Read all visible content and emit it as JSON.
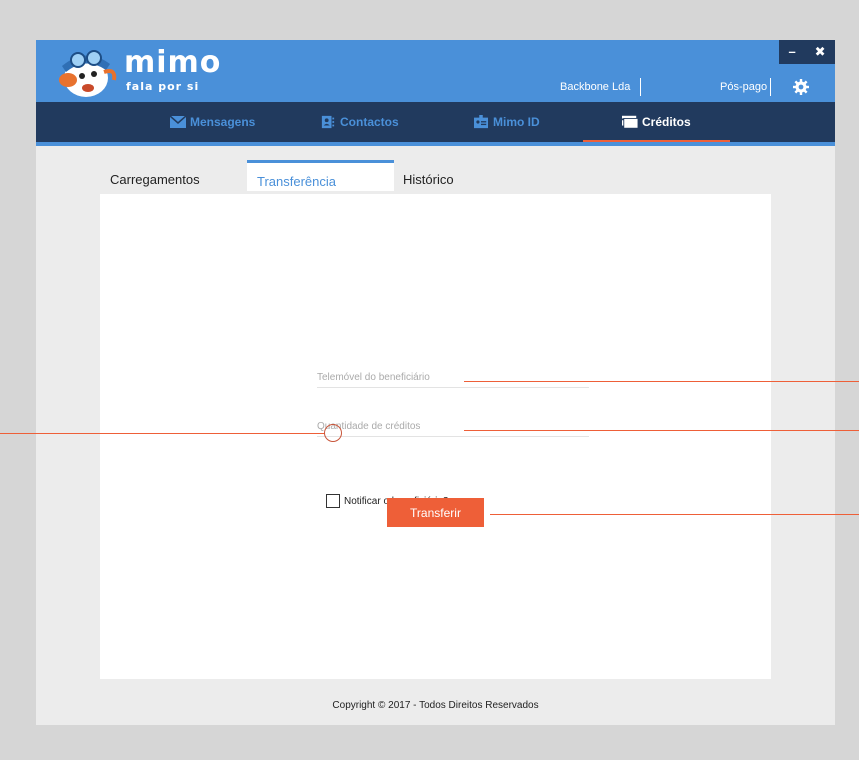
{
  "app": {
    "brand": "mimo",
    "tagline": "fala por si",
    "account_name": "Backbone Lda",
    "plan": "Pós-pago",
    "window_controls": {
      "minimize": "–",
      "close": "✖"
    }
  },
  "nav": {
    "items": [
      {
        "label": "Mensagens",
        "icon": "envelope-icon"
      },
      {
        "label": "Contactos",
        "icon": "contacts-icon"
      },
      {
        "label": "Mimo ID",
        "icon": "id-card-icon"
      },
      {
        "label": "Créditos",
        "icon": "credit-card-icon",
        "active": true
      }
    ]
  },
  "tabs": [
    {
      "label": "Carregamentos"
    },
    {
      "label": "Transferência",
      "active": true
    },
    {
      "label": "Histórico"
    }
  ],
  "form": {
    "phone_placeholder": "Telemóvel do beneficiário",
    "amount_placeholder": "Quantidade de créditos",
    "notify_label": "Notificar o beneficiário?",
    "notify_checked": false,
    "submit_label": "Transferir"
  },
  "footer": {
    "copyright": "Copyright © 2017 - Todos Direitos Reservados"
  },
  "colors": {
    "brand_blue": "#4a90d9",
    "nav_dark": "#213a5e",
    "accent_orange": "#ee5f38",
    "background": "#d6d6d6"
  }
}
